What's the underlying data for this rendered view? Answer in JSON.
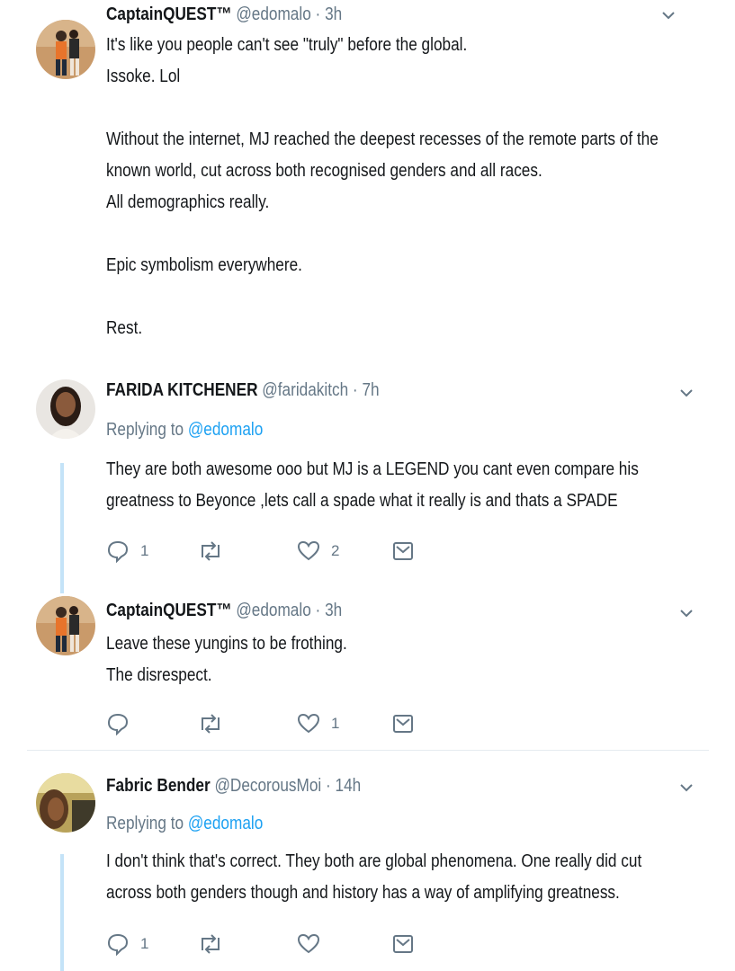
{
  "tweets": [
    {
      "name": "CaptainQUEST™",
      "handle": "@edomalo",
      "sep": "·",
      "time": "3h",
      "replying_to_label": "",
      "replying_to": "",
      "lines": [
        "It's like you people can't see \"truly\" before the global.",
        "Issoke. Lol",
        "",
        "Without the internet, MJ reached the deepest recesses of the remote parts of the",
        "known world, cut across both recognised genders and all races.",
        "All demographics really.",
        "",
        "Epic symbolism everywhere.",
        "",
        "Rest."
      ]
    },
    {
      "name": "FARIDA KITCHENER",
      "handle": "@faridakitch",
      "sep": "·",
      "time": "7h",
      "replying_to_label": "Replying to",
      "replying_to": "@edomalo",
      "lines": [
        "They are both awesome ooo but MJ is a LEGEND you cant even compare his",
        "greatness to Beyonce ,lets call a spade what it really is and thats a SPADE"
      ],
      "reply_count": "1",
      "retweet_count": "",
      "like_count": "2"
    },
    {
      "name": "CaptainQUEST™",
      "handle": "@edomalo",
      "sep": "·",
      "time": "3h",
      "replying_to_label": "",
      "replying_to": "",
      "lines": [
        "Leave these yungins to be frothing.",
        "The disrespect."
      ],
      "reply_count": "",
      "retweet_count": "",
      "like_count": "1"
    },
    {
      "name": "Fabric Bender",
      "handle": "@DecorousMoi",
      "sep": "·",
      "time": "14h",
      "replying_to_label": "Replying to",
      "replying_to": "@edomalo",
      "lines": [
        "I don't think that's correct. They both are global phenomena. One really did cut",
        "across both genders though and history has a way of amplifying greatness."
      ],
      "reply_count": "1",
      "retweet_count": "",
      "like_count": ""
    }
  ],
  "colors": {
    "text": "#14171a",
    "secondary": "#657786",
    "link": "#1da1f2",
    "thread_line": "#c4e3f8"
  },
  "icons": {
    "reply": "reply-icon",
    "retweet": "retweet-icon",
    "like": "heart-icon",
    "dm": "envelope-icon",
    "menu": "chevron-down-icon"
  }
}
